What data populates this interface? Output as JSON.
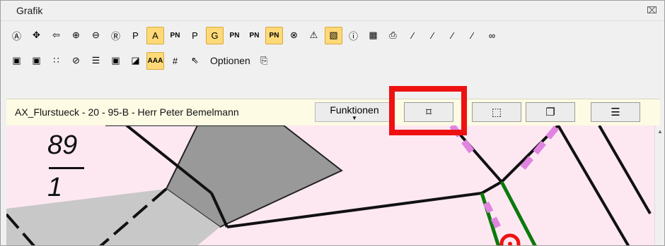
{
  "window": {
    "title": "Grafik",
    "close_glyph": "⌧"
  },
  "toolbar_row1": [
    {
      "name": "zoom-a-icon",
      "glyph": "Ⓐ",
      "selected": false
    },
    {
      "name": "zoom-extent-icon",
      "glyph": "✥",
      "selected": false
    },
    {
      "name": "back-arrow-icon",
      "glyph": "⇦",
      "selected": false
    },
    {
      "name": "zoom-in-icon",
      "glyph": "⊕",
      "selected": false
    },
    {
      "name": "zoom-out-icon",
      "glyph": "⊖",
      "selected": false
    },
    {
      "name": "zoom-r-icon",
      "glyph": "Ⓡ",
      "selected": false
    },
    {
      "name": "label-p-icon",
      "glyph": "P",
      "selected": false
    },
    {
      "name": "label-a-icon",
      "glyph": "A",
      "selected": true
    },
    {
      "name": "label-pn-green-icon",
      "glyph": "PN",
      "selected": false
    },
    {
      "name": "label-p-blue-icon",
      "glyph": "P",
      "selected": false
    },
    {
      "name": "label-g-icon",
      "glyph": "G",
      "selected": true
    },
    {
      "name": "label-pn-gray-icon",
      "glyph": "PN",
      "selected": false
    },
    {
      "name": "label-pn-red-icon",
      "glyph": "PN",
      "selected": false
    },
    {
      "name": "label-pn-selected-icon",
      "glyph": "PN",
      "selected": true
    },
    {
      "name": "cancel-circle-icon",
      "glyph": "⊗",
      "selected": false
    },
    {
      "name": "warning-icon",
      "glyph": "⚠",
      "selected": false
    },
    {
      "name": "hatch-icon",
      "glyph": "▧",
      "selected": true
    },
    {
      "name": "info-icon",
      "glyph": "ⓘ",
      "selected": false
    },
    {
      "name": "grid-layer-icon",
      "glyph": "▦",
      "selected": false
    },
    {
      "name": "print-icon",
      "glyph": "⎙",
      "selected": false
    },
    {
      "name": "line-add-icon",
      "glyph": "⁄",
      "selected": false
    },
    {
      "name": "line-remove-icon",
      "glyph": "⁄",
      "selected": false
    },
    {
      "name": "line-split-icon",
      "glyph": "⁄",
      "selected": false
    },
    {
      "name": "line-draw-icon",
      "glyph": "∕",
      "selected": false
    },
    {
      "name": "binoculars-icon",
      "glyph": "∞",
      "selected": false
    }
  ],
  "toolbar_row2": [
    {
      "name": "layer-remove-icon",
      "glyph": "▣",
      "selected": false
    },
    {
      "name": "layer-add-icon",
      "glyph": "▣",
      "selected": false
    },
    {
      "name": "point-grid-icon",
      "glyph": "∷",
      "selected": false
    },
    {
      "name": "edit-disabled-icon",
      "glyph": "⊘",
      "selected": false
    },
    {
      "name": "traffic-light-icon",
      "glyph": "☰",
      "selected": false
    },
    {
      "name": "square-dot-icon",
      "glyph": "▣",
      "selected": false
    },
    {
      "name": "contrast-icon",
      "glyph": "◪",
      "selected": false
    },
    {
      "name": "text-a-icon",
      "glyph": "AAA",
      "selected": true
    },
    {
      "name": "hash-icon",
      "glyph": "#",
      "selected": false
    },
    {
      "name": "pointer-icon",
      "glyph": "⇖",
      "selected": false
    }
  ],
  "options": {
    "label": "Optionen",
    "icon_glyph": "⎘"
  },
  "infobar": {
    "object_label": "AX_Flurstueck - 20 - 95-B - Herr Peter Bemelmann",
    "functions_label": "Funktionen",
    "functions_arrow": "▼",
    "buttons": [
      {
        "name": "crop-button",
        "glyph": "⌑"
      },
      {
        "name": "frame-button",
        "glyph": "⬚"
      },
      {
        "name": "cube-button",
        "glyph": "❐"
      },
      {
        "name": "list-button",
        "glyph": "☰"
      }
    ]
  },
  "map": {
    "parcel_number_top": "89",
    "parcel_number_bottom": "1"
  },
  "colors": {
    "highlight": "#ee1111",
    "map_background": "#fde8f2",
    "selected_tool": "#ffd978"
  }
}
